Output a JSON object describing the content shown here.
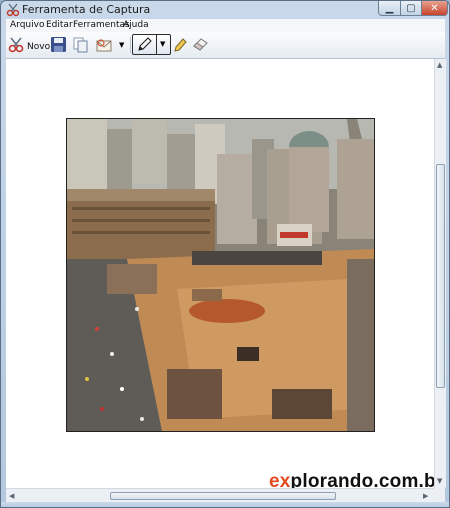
{
  "window": {
    "title": "Ferramenta de Captura"
  },
  "menu": {
    "items": [
      "Arquivo",
      "Editar",
      "Ferramentas",
      "Ajuda"
    ]
  },
  "toolbar": {
    "new_label": "Novo"
  },
  "watermark": "explorando.com.br",
  "colors": {
    "accent": "#3c7fb1",
    "watermark_accent": "#e34a1f",
    "title_close": "#c9432c"
  },
  "icons": [
    "scissors-icon",
    "save-icon",
    "copy-icon",
    "send-email-icon",
    "dropdown-arrow-icon",
    "pen-icon",
    "highlighter-icon",
    "eraser-icon"
  ]
}
